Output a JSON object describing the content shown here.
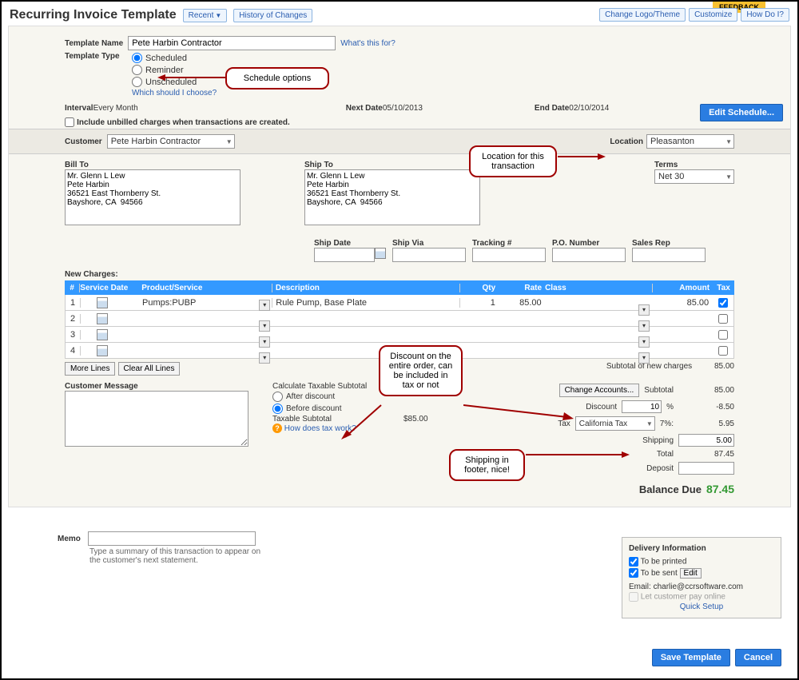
{
  "header": {
    "title": "Recurring Invoice Template",
    "recent": "Recent",
    "history": "History of Changes",
    "feedback": "FEEDBACK",
    "change_logo": "Change Logo/Theme",
    "customize": "Customize",
    "how_do_i": "How Do I?"
  },
  "template": {
    "name_lbl": "Template Name",
    "name_val": "Pete Harbin Contractor",
    "whats_this": "What's this for?",
    "type_lbl": "Template Type",
    "opt_scheduled": "Scheduled",
    "opt_reminder": "Reminder",
    "opt_unscheduled": "Unscheduled",
    "which_link": "Which should I choose?"
  },
  "annotations": {
    "schedule": "Schedule options",
    "location": "Location for this transaction",
    "discount": "Discount on the entire order, can be included in tax or not",
    "shipping": "Shipping in footer, nice!"
  },
  "interval": {
    "interval_lbl": "Interval",
    "interval_val": "Every Month",
    "next_lbl": "Next Date",
    "next_val": "05/10/2013",
    "end_lbl": "End Date",
    "end_val": "02/10/2014",
    "edit_btn": "Edit Schedule...",
    "include_unbilled": "Include unbilled charges when transactions are created."
  },
  "customer": {
    "lbl": "Customer",
    "val": "Pete Harbin Contractor",
    "location_lbl": "Location",
    "location_val": "Pleasanton"
  },
  "addresses": {
    "bill_lbl": "Bill To",
    "bill_val": "Mr. Glenn L Lew\nPete Harbin\n36521 East Thornberry St.\nBayshore, CA  94566",
    "ship_lbl": "Ship To",
    "ship_val": "Mr. Glenn L Lew\nPete Harbin\n36521 East Thornberry St.\nBayshore, CA  94566",
    "terms_lbl": "Terms",
    "terms_val": "Net 30"
  },
  "ship_fields": {
    "date": "Ship Date",
    "via": "Ship Via",
    "tracking": "Tracking #",
    "po": "P.O. Number",
    "rep": "Sales Rep"
  },
  "grid": {
    "title": "New Charges:",
    "h_num": "#",
    "h_date": "Service Date",
    "h_prod": "Product/Service",
    "h_desc": "Description",
    "h_qty": "Qty",
    "h_rate": "Rate",
    "h_class": "Class",
    "h_amt": "Amount",
    "h_tax": "Tax",
    "rows": [
      {
        "n": "1",
        "prod": "Pumps:PUBP",
        "desc": "Rule Pump, Base Plate",
        "qty": "1",
        "rate": "85.00",
        "amt": "85.00",
        "tax": true
      },
      {
        "n": "2"
      },
      {
        "n": "3"
      },
      {
        "n": "4"
      }
    ],
    "more_lines": "More Lines",
    "clear_all": "Clear All Lines"
  },
  "totals": {
    "subtotal_new_lbl": "Subtotal of new charges",
    "subtotal_new": "85.00",
    "change_accts": "Change Accounts...",
    "subtotal_lbl": "Subtotal",
    "subtotal": "85.00",
    "discount_lbl": "Discount",
    "discount_pct": "10",
    "discount_val": "-8.50",
    "tax_lbl": "Tax",
    "tax_name": "California Tax",
    "tax_pct": "7%:",
    "tax_val": "5.95",
    "shipping_lbl": "Shipping",
    "shipping_val": "5.00",
    "total_lbl": "Total",
    "total_val": "87.45",
    "deposit_lbl": "Deposit",
    "balance_lbl": "Balance Due",
    "balance_val": "87.45"
  },
  "calc": {
    "cust_msg_lbl": "Customer Message",
    "title": "Calculate Taxable Subtotal",
    "after": "After discount",
    "before": "Before discount",
    "taxable_lbl": "Taxable Subtotal",
    "taxable_val": "$85.00",
    "how_tax": "How does tax work?"
  },
  "memo": {
    "lbl": "Memo",
    "hint": "Type a summary of this transaction to appear on the customer's next statement."
  },
  "delivery": {
    "title": "Delivery Information",
    "printed": "To be printed",
    "sent": "To be sent",
    "edit": "Edit",
    "email_lbl": "Email:",
    "email_val": "charlie@ccrsoftware.com",
    "pay_online": "Let customer pay online",
    "quick_setup": "Quick Setup"
  },
  "footer": {
    "save": "Save Template",
    "cancel": "Cancel"
  }
}
